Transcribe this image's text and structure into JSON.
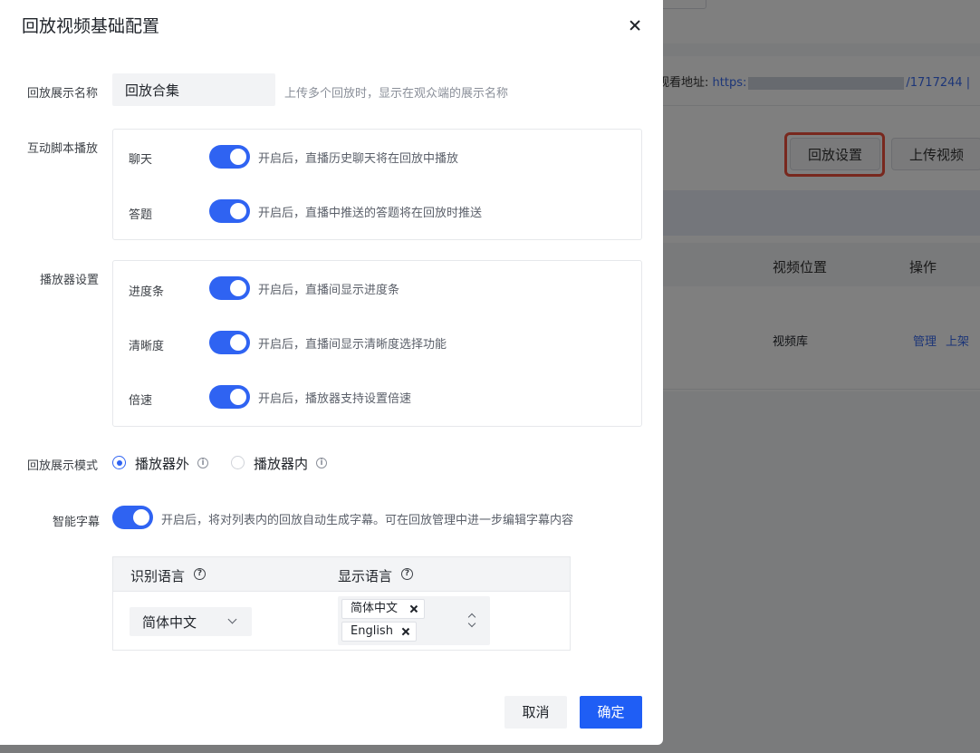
{
  "background": {
    "url_label": "观看地址:",
    "url_prefix": "https:",
    "url_suffix": "/1717244",
    "url_tail": "|",
    "replay_settings_button": "回放设置",
    "upload_video_button": "上传视频",
    "table_headers": [
      "视频位置",
      "操作"
    ],
    "row": {
      "position": "视频库",
      "actions": [
        "管理",
        "上架"
      ]
    }
  },
  "modal": {
    "title": "回放视频基础配置",
    "display_name": {
      "label": "回放展示名称",
      "value": "回放合集",
      "hint": "上传多个回放时，显示在观众端的展示名称"
    },
    "interactive": {
      "label": "互动脚本播放",
      "rows": [
        {
          "label": "聊天",
          "hint": "开启后，直播历史聊天将在回放中播放",
          "enabled": true
        },
        {
          "label": "答题",
          "hint": "开启后，直播中推送的答题将在回放时推送",
          "enabled": true
        }
      ]
    },
    "player": {
      "label": "播放器设置",
      "rows": [
        {
          "label": "进度条",
          "hint": "开启后，直播间显示进度条",
          "enabled": true
        },
        {
          "label": "清晰度",
          "hint": "开启后，直播间显示清晰度选择功能",
          "enabled": true
        },
        {
          "label": "倍速",
          "hint": "开启后，播放器支持设置倍速",
          "enabled": true
        }
      ]
    },
    "display_mode": {
      "label": "回放展示模式",
      "options": [
        "播放器外",
        "播放器内"
      ],
      "selected": "播放器外"
    },
    "subtitle": {
      "label": "智能字幕",
      "enabled": true,
      "hint": "开启后，将对列表内的回放自动生成字幕。可在回放管理中进一步编辑字幕内容",
      "table": {
        "recognize_header": "识别语言",
        "display_header": "显示语言",
        "recognize_value": "简体中文",
        "display_tags": [
          "简体中文",
          "English"
        ]
      }
    },
    "cancel_label": "取消",
    "ok_label": "确定"
  },
  "colors": {
    "primary": "#1f5ef5",
    "highlight": "#f0503c"
  }
}
